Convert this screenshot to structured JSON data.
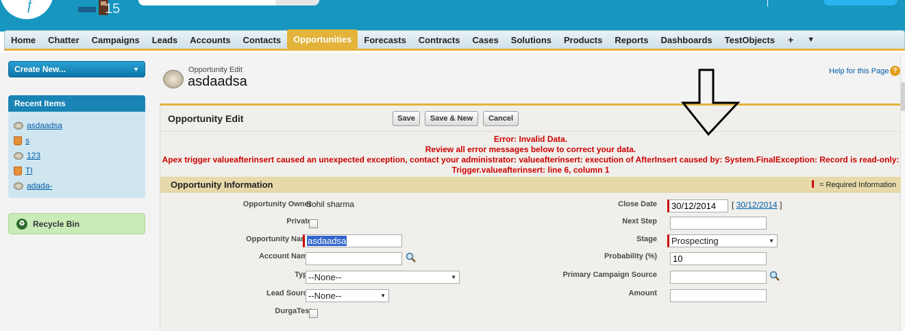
{
  "header": {
    "logo_text": "f",
    "release_number": "15"
  },
  "tabs": [
    {
      "label": "Home",
      "active": false
    },
    {
      "label": "Chatter",
      "active": false
    },
    {
      "label": "Campaigns",
      "active": false
    },
    {
      "label": "Leads",
      "active": false
    },
    {
      "label": "Accounts",
      "active": false
    },
    {
      "label": "Contacts",
      "active": false
    },
    {
      "label": "Opportunities",
      "active": true
    },
    {
      "label": "Forecasts",
      "active": false
    },
    {
      "label": "Contracts",
      "active": false
    },
    {
      "label": "Cases",
      "active": false
    },
    {
      "label": "Solutions",
      "active": false
    },
    {
      "label": "Products",
      "active": false
    },
    {
      "label": "Reports",
      "active": false
    },
    {
      "label": "Dashboards",
      "active": false
    },
    {
      "label": "TestObjects",
      "active": false
    }
  ],
  "tab_icons": {
    "plus": "+",
    "more": "▼"
  },
  "sidebar": {
    "create_new_label": "Create New...",
    "recent_title": "Recent Items",
    "recent_items": [
      {
        "label": "asdaadsa",
        "icon": "opportunity-icon"
      },
      {
        "label": "s",
        "icon": "account-icon"
      },
      {
        "label": "123",
        "icon": "opportunity-icon"
      },
      {
        "label": "TI",
        "icon": "account-icon"
      },
      {
        "label": "adada-",
        "icon": "opportunity-icon"
      }
    ],
    "recycle_bin_label": "Recycle Bin"
  },
  "page": {
    "subtitle": "Opportunity Edit",
    "title": "asdaadsa",
    "help_label": "Help for this Page",
    "help_icon": "?"
  },
  "panel": {
    "title": "Opportunity Edit",
    "save_label": "Save",
    "save_new_label": "Save & New",
    "cancel_label": "Cancel"
  },
  "errors": {
    "line1": "Error: Invalid Data.",
    "line2": "Review all error messages below to correct your data.",
    "line3": "Apex trigger valueafterinsert caused an unexpected exception, contact your administrator: valueafterinsert: execution of AfterInsert caused by: System.FinalException: Record is read-only:",
    "line4": "Trigger.valueafterinsert: line 6, column 1"
  },
  "section": {
    "title": "Opportunity Information",
    "required_note": "= Required Information"
  },
  "fields": {
    "owner_label": "Opportunity Owner",
    "owner_value": "Sohil sharma",
    "private_label": "Private",
    "name_label": "Opportunity Name",
    "name_value": "asdaadsa",
    "account_label": "Account Name",
    "account_value": "",
    "type_label": "Type",
    "type_value": "--None--",
    "lead_source_label": "Lead Source",
    "lead_source_value": "--None--",
    "durga_label": "DurgaTest",
    "close_date_label": "Close Date",
    "close_date_value": "30/12/2014",
    "close_date_link": "30/12/2014",
    "next_step_label": "Next Step",
    "next_step_value": "",
    "stage_label": "Stage",
    "stage_value": "Prospecting",
    "probability_label": "Probability (%)",
    "probability_value": "10",
    "campaign_label": "Primary Campaign Source",
    "campaign_value": "",
    "amount_label": "Amount",
    "amount_value": ""
  },
  "colors": {
    "header_blue": "#1797c0",
    "active_tab": "#e3b33a",
    "error_red": "#cc0000",
    "link_blue": "#015ba7"
  }
}
